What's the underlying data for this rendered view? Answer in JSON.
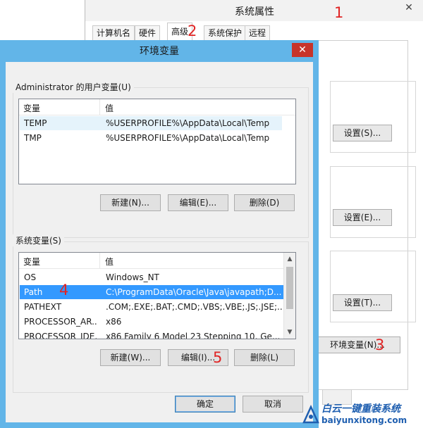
{
  "sys_props": {
    "title": "系统属性",
    "close_glyph": "✕",
    "tabs": [
      {
        "label": "计算机名",
        "active": false
      },
      {
        "label": "硬件",
        "active": false
      },
      {
        "label": "高级",
        "active": true
      },
      {
        "label": "系统保护",
        "active": false
      },
      {
        "label": "远程",
        "active": false
      }
    ],
    "settings_buttons": [
      "设置(S)...",
      "设置(E)...",
      "设置(T)..."
    ],
    "env_button": "环境变量(N)..."
  },
  "env_dialog": {
    "title": "环境变量",
    "close_glyph": "✕",
    "user_vars": {
      "legend": "Administrator 的用户变量(U)",
      "columns": [
        "变量",
        "值"
      ],
      "rows": [
        {
          "name": "TEMP",
          "value": "%USERPROFILE%\\AppData\\Local\\Temp"
        },
        {
          "name": "TMP",
          "value": "%USERPROFILE%\\AppData\\Local\\Temp"
        }
      ],
      "buttons": [
        "新建(N)...",
        "编辑(E)...",
        "删除(D)"
      ]
    },
    "system_vars": {
      "legend": "系统变量(S)",
      "columns": [
        "变量",
        "值"
      ],
      "rows": [
        {
          "name": "OS",
          "value": "Windows_NT"
        },
        {
          "name": "Path",
          "value": "C:\\ProgramData\\Oracle\\Java\\javapath;D..."
        },
        {
          "name": "PATHEXT",
          "value": ".COM;.EXE;.BAT;.CMD;.VBS;.VBE;.JS;.JSE;..."
        },
        {
          "name": "PROCESSOR_AR...",
          "value": "x86"
        },
        {
          "name": "PROCESSOR_IDE...",
          "value": "x86 Family 6 Model 23 Stepping 10, Ge..."
        }
      ],
      "selected_row": "Path",
      "buttons": [
        "新建(W)...",
        "编辑(I)...",
        "删除(L)"
      ]
    },
    "ok_button": "确定",
    "cancel_button": "取消"
  },
  "annotations": [
    "1",
    "2",
    "3",
    "4",
    "5"
  ],
  "watermark": {
    "line1": "白云一键重装系统",
    "line2": "baiyunxitong.com"
  },
  "colors": {
    "dialog_frame": "#62b5e8",
    "close_button": "#c7342a",
    "selection": "#3399ff",
    "annotation": "#e02424",
    "watermark": "#1f5fb0"
  }
}
